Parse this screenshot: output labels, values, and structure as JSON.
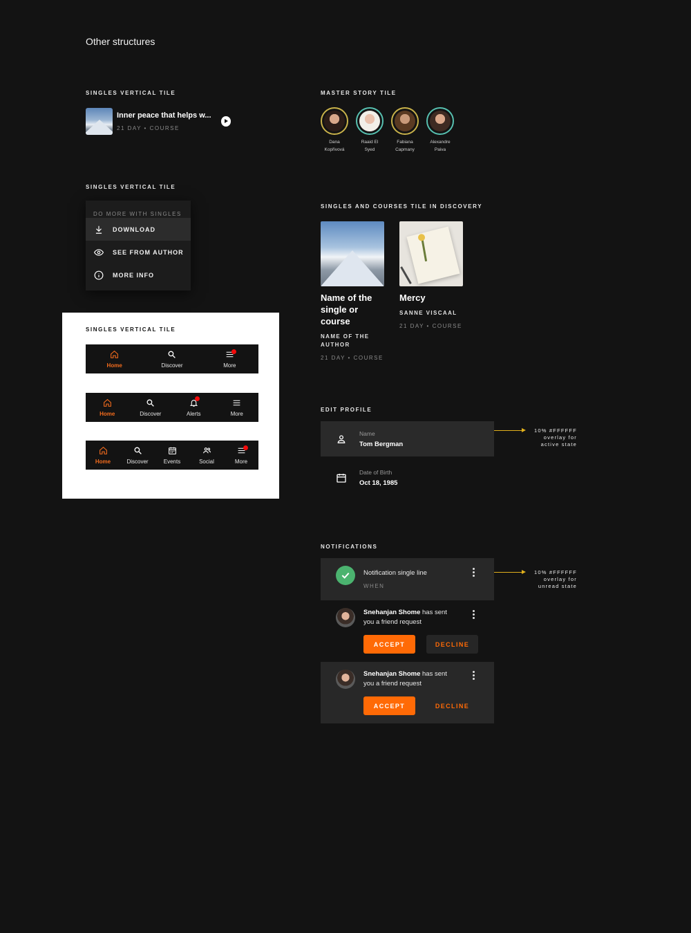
{
  "page_title": "Other structures",
  "singles_tile": {
    "label": "SINGLES VERTICAL TILE",
    "title": "Inner peace that helps w...",
    "meta": "21 DAY • COURSE"
  },
  "story_tile": {
    "label": "MASTER STORY TILE",
    "stories": [
      {
        "line1": "Dana",
        "line2": "Kopřivová"
      },
      {
        "line1": "Raaid El",
        "line2": "Syed"
      },
      {
        "line1": "Fabiana",
        "line2": "Capmany"
      },
      {
        "line1": "Alexandre",
        "line2": "Paiva"
      }
    ]
  },
  "menu_section": {
    "label": "SINGLES VERTICAL TILE",
    "header": "DO MORE WITH SINGLES",
    "items": [
      {
        "label": "DOWNLOAD",
        "icon": "download-icon"
      },
      {
        "label": "SEE FROM AUTHOR",
        "icon": "eye-icon"
      },
      {
        "label": "MORE INFO",
        "icon": "info-icon"
      }
    ]
  },
  "nav_section": {
    "label": "SINGLES VERTICAL TILE",
    "nav3": [
      "Home",
      "Discover",
      "More"
    ],
    "nav4": [
      "Home",
      "Discover",
      "Alerts",
      "More"
    ],
    "nav5": [
      "Home",
      "Discover",
      "Events",
      "Social",
      "More"
    ],
    "accent": "#F26B1D",
    "badge_color": "#F20A0A"
  },
  "discovery": {
    "label": "SINGLES AND COURSES TILE IN DISCOVERY",
    "tiles": [
      {
        "title_lines": [
          "Name of the",
          "single or",
          "course"
        ],
        "author_lines": [
          "NAME OF THE",
          "AUTHOR"
        ],
        "meta": "21 DAY • COURSE"
      },
      {
        "title_lines": [
          "Mercy"
        ],
        "author_lines": [
          "SANNE VISCAAL"
        ],
        "meta": "21 DAY • COURSE"
      }
    ]
  },
  "edit_profile": {
    "label": "EDIT PROFILE",
    "fields": [
      {
        "label": "Name",
        "value": "Tom Bergman",
        "icon": "person-icon"
      },
      {
        "label": "Date of Birth",
        "value": "Oct 18, 1985",
        "icon": "calendar-icon"
      }
    ],
    "annotation": [
      "10% #FFFFFF",
      "overlay for",
      "active state"
    ]
  },
  "notifications": {
    "label": "NOTIFICATIONS",
    "first": {
      "text": "Notification single line",
      "meta": "WHEN"
    },
    "annotation": [
      "10% #FFFFFF",
      "overlay for",
      "unread state"
    ],
    "friend_requests": [
      {
        "name": "Snehanjan Shome",
        "text": "has sent",
        "text2": "you a friend request",
        "accept": "ACCEPT",
        "decline": "DECLINE"
      },
      {
        "name": "Snehanjan Shome",
        "text": "has sent",
        "text2": "you a friend request",
        "accept": "ACCEPT",
        "decline": "DECLINE"
      }
    ],
    "accent": "#FF6A06",
    "success": "#4BB36F"
  }
}
